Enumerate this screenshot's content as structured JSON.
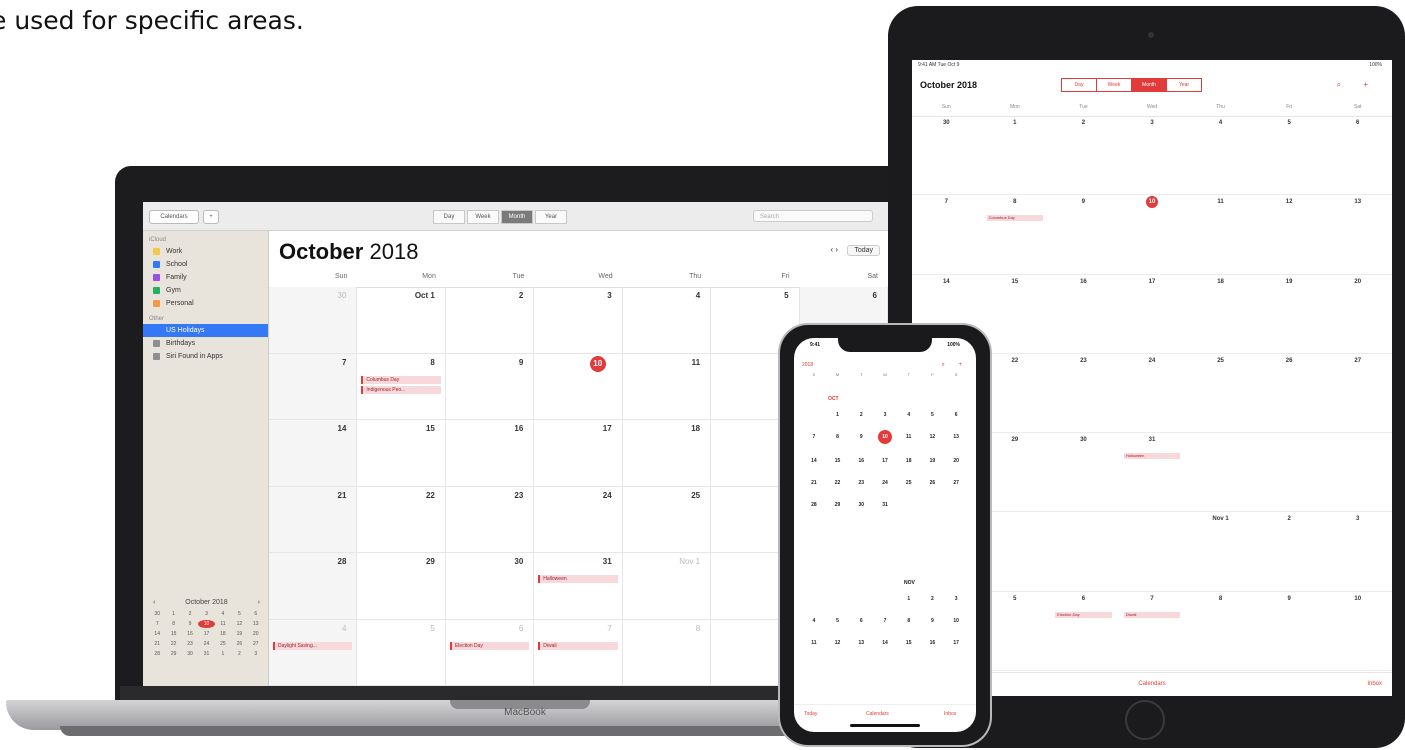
{
  "caption": "e used for specific areas.",
  "colors": {
    "accent": "#e23b3b",
    "selection": "#3478f6"
  },
  "macbook": {
    "device_label": "MacBook",
    "toolbar": {
      "calendars_button": "Calendars",
      "add_button": "+",
      "segments": [
        "Day",
        "Week",
        "Month",
        "Year"
      ],
      "active_segment": "Month",
      "search_placeholder": "Search"
    },
    "sidebar": {
      "icloud_header": "iCloud",
      "calendars": [
        {
          "label": "Work",
          "color": "#f2c94c"
        },
        {
          "label": "School",
          "color": "#3478f6"
        },
        {
          "label": "Family",
          "color": "#9b51e0"
        },
        {
          "label": "Gym",
          "color": "#27ae60"
        },
        {
          "label": "Personal",
          "color": "#f2994a"
        }
      ],
      "other_header": "Other",
      "others": [
        {
          "label": "US Holidays",
          "color": "#3478f6",
          "selected": true
        },
        {
          "label": "Birthdays",
          "color": "#8e8e93"
        },
        {
          "label": "Siri Found in Apps",
          "color": "#8e8e93"
        }
      ],
      "mini_calendar": {
        "month": "October 2018",
        "prev": "‹",
        "next": "›",
        "days": [
          "30",
          "1",
          "2",
          "3",
          "4",
          "5",
          "6",
          "7",
          "8",
          "9",
          "10",
          "11",
          "12",
          "13",
          "14",
          "15",
          "16",
          "17",
          "18",
          "19",
          "20",
          "21",
          "22",
          "23",
          "24",
          "25",
          "26",
          "27",
          "28",
          "29",
          "30",
          "31",
          "1",
          "2",
          "3"
        ],
        "today": "10"
      }
    },
    "main": {
      "title_month": "October",
      "title_year": "2018",
      "today_button": "Today",
      "nav": "‹  ›",
      "weekdays": [
        "Sun",
        "Mon",
        "Tue",
        "Wed",
        "Thu",
        "Fri",
        "Sat"
      ],
      "cells": [
        {
          "d": "30",
          "dim": true
        },
        {
          "d": "Oct 1"
        },
        {
          "d": "2"
        },
        {
          "d": "3"
        },
        {
          "d": "4"
        },
        {
          "d": "5"
        },
        {
          "d": "6"
        },
        {
          "d": "7"
        },
        {
          "d": "8",
          "events": [
            "Columbus Day",
            "Indigenous Peo..."
          ]
        },
        {
          "d": "9"
        },
        {
          "d": "10",
          "today": true
        },
        {
          "d": "11"
        },
        {
          "d": "12"
        },
        {
          "d": "13"
        },
        {
          "d": "14"
        },
        {
          "d": "15"
        },
        {
          "d": "16"
        },
        {
          "d": "17"
        },
        {
          "d": "18"
        },
        {
          "d": "19"
        },
        {
          "d": "20"
        },
        {
          "d": "21"
        },
        {
          "d": "22"
        },
        {
          "d": "23"
        },
        {
          "d": "24"
        },
        {
          "d": "25"
        },
        {
          "d": "26"
        },
        {
          "d": "27"
        },
        {
          "d": "28"
        },
        {
          "d": "29"
        },
        {
          "d": "30"
        },
        {
          "d": "31",
          "events": [
            "Halloween"
          ]
        },
        {
          "d": "Nov 1",
          "dim": true
        },
        {
          "d": "2",
          "dim": true
        },
        {
          "d": "3",
          "dim": true
        },
        {
          "d": "4",
          "dim": true,
          "events": [
            "Daylight Saving..."
          ]
        },
        {
          "d": "5",
          "dim": true
        },
        {
          "d": "6",
          "dim": true,
          "events": [
            "Election Day"
          ]
        },
        {
          "d": "7",
          "dim": true,
          "events": [
            "Diwali"
          ]
        },
        {
          "d": "8",
          "dim": true
        },
        {
          "d": "9",
          "dim": true
        },
        {
          "d": "10",
          "dim": true
        }
      ]
    }
  },
  "ipad": {
    "status_left": "9:41 AM  Tue Oct 9",
    "status_right": "100%",
    "title": "October 2018",
    "segments": [
      "Day",
      "Week",
      "Month",
      "Year"
    ],
    "active_segment": "Month",
    "icons": "⌕ +",
    "weekdays": [
      "Sun",
      "Mon",
      "Tue",
      "Wed",
      "Thu",
      "Fri",
      "Sat"
    ],
    "cells": [
      {
        "d": "30"
      },
      {
        "d": "1"
      },
      {
        "d": "2"
      },
      {
        "d": "3"
      },
      {
        "d": "4"
      },
      {
        "d": "5"
      },
      {
        "d": "6"
      },
      {
        "d": "7"
      },
      {
        "d": "8",
        "events": [
          "Columbus Day"
        ]
      },
      {
        "d": "9"
      },
      {
        "d": "10",
        "today": true
      },
      {
        "d": "11"
      },
      {
        "d": "12"
      },
      {
        "d": "13"
      },
      {
        "d": "14"
      },
      {
        "d": "15"
      },
      {
        "d": "16"
      },
      {
        "d": "17"
      },
      {
        "d": "18"
      },
      {
        "d": "19"
      },
      {
        "d": "20"
      },
      {
        "d": "21"
      },
      {
        "d": "22"
      },
      {
        "d": "23"
      },
      {
        "d": "24"
      },
      {
        "d": "25"
      },
      {
        "d": "26"
      },
      {
        "d": "27"
      },
      {
        "d": "28"
      },
      {
        "d": "29"
      },
      {
        "d": "30"
      },
      {
        "d": "31",
        "events": [
          "Halloween"
        ]
      },
      {
        "d": ""
      },
      {
        "d": ""
      },
      {
        "d": ""
      },
      {
        "d": ""
      },
      {
        "d": ""
      },
      {
        "d": ""
      },
      {
        "d": ""
      },
      {
        "d": "Nov 1"
      },
      {
        "d": "2"
      },
      {
        "d": "3"
      },
      {
        "d": "4"
      },
      {
        "d": "5"
      },
      {
        "d": "6",
        "events": [
          "Election Day"
        ]
      },
      {
        "d": "7",
        "events": [
          "Diwali"
        ]
      },
      {
        "d": "8"
      },
      {
        "d": "9"
      },
      {
        "d": "10"
      }
    ],
    "tab_center": "Calendars",
    "tab_right": "Inbox"
  },
  "iphone": {
    "time": "9:41",
    "status_right": "100%",
    "back": "2018",
    "icons": "⌕ +",
    "weekdays": [
      "S",
      "M",
      "T",
      "W",
      "T",
      "F",
      "S"
    ],
    "oct_label": "OCT",
    "oct_days": [
      "",
      "1",
      "2",
      "3",
      "4",
      "5",
      "6",
      "7",
      "8",
      "9",
      "10",
      "11",
      "12",
      "13",
      "14",
      "15",
      "16",
      "17",
      "18",
      "19",
      "20",
      "21",
      "22",
      "23",
      "24",
      "25",
      "26",
      "27",
      "28",
      "29",
      "30",
      "31",
      "",
      "",
      ""
    ],
    "oct_today": "10",
    "nov_label": "NOV",
    "nov_days": [
      "",
      "",
      "",
      "",
      "1",
      "2",
      "3",
      "4",
      "5",
      "6",
      "7",
      "8",
      "9",
      "10",
      "11",
      "12",
      "13",
      "14",
      "15",
      "16",
      "17"
    ],
    "tabs": [
      "Today",
      "Calendars",
      "Inbox"
    ]
  }
}
